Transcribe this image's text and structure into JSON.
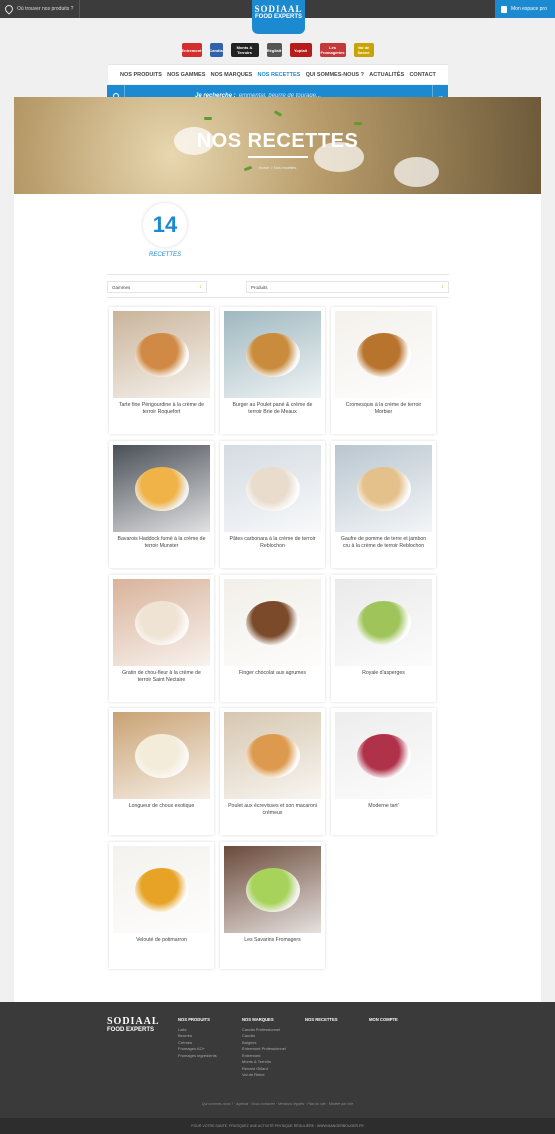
{
  "topbar": {
    "where_label": "Où trouver nos produits ?",
    "pro_label": "Mon espace pro"
  },
  "logo": {
    "line1": "SODIAAL",
    "line2": "FOOD EXPERTS"
  },
  "brands": [
    {
      "name": "Entremont",
      "color": "#d32f2f"
    },
    {
      "name": "Candia",
      "color": "#2f62a8"
    },
    {
      "name": "Monts & Terroirs",
      "color": "#222222"
    },
    {
      "name": "Régilait",
      "color": "#555555"
    },
    {
      "name": "Yoplait",
      "color": "#b71c1c"
    },
    {
      "name": "Les Fromageries",
      "color": "#c43a3a"
    },
    {
      "name": "Val de Saône",
      "color": "#c8a400"
    }
  ],
  "nav": [
    "NOS PRODUITS",
    "NOS GAMMES",
    "NOS MARQUES",
    "NOS RECETTES",
    "QUI SOMMES-NOUS ?",
    "ACTUALITÉS",
    "CONTACT"
  ],
  "nav_active_index": 3,
  "search": {
    "label": "Je recherche :",
    "placeholder": "emmental, beurre de tourage..."
  },
  "hero": {
    "title": "NOS RECETTES",
    "breadcrumb": "Home > Nos recettes"
  },
  "count": {
    "number": "14",
    "label": "RECETTES"
  },
  "filters": {
    "gammes": "Gammes",
    "produits": "Produits"
  },
  "recipes": [
    {
      "title": "Tarte fine Périgourdine à la crème de terroir Roquefort",
      "bg": "#c9b49a",
      "accent": "#d08a45"
    },
    {
      "title": "Burger au Poulet pané & crème de terroir Brie de Meaux",
      "bg": "#9fb8c0",
      "accent": "#c98b3c"
    },
    {
      "title": "Cromesquis à la crème de terroir Morbier",
      "bg": "#f4f1ec",
      "accent": "#b8732c"
    },
    {
      "title": "Bavarois Haddock fumé à la crème de terroir Munster",
      "bg": "#4a4f57",
      "accent": "#efb347"
    },
    {
      "title": "Pâtes carbonara à la crème de terroir Reblochon",
      "bg": "#d4dbe2",
      "accent": "#e9dccd"
    },
    {
      "title": "Gaufre de pomme de terre et jambon cru à la crème de terroir Reblochon",
      "bg": "#b9c6d0",
      "accent": "#e4c08a"
    },
    {
      "title": "Gratin de chou-fleur à la crème de terroir Saint Nectaire",
      "bg": "#d8b39a",
      "accent": "#efe3d3"
    },
    {
      "title": "Finger chocolat aux agrumes",
      "bg": "#f2efe9",
      "accent": "#7a4a2a"
    },
    {
      "title": "Royale d'asperges",
      "bg": "#eaeaea",
      "accent": "#9fc45a"
    },
    {
      "title": "Longueur de choux exotique",
      "bg": "#c9a273",
      "accent": "#f3ecd9"
    },
    {
      "title": "Poulet aux écrevisses et son macaroni crémeux",
      "bg": "#d6c7b0",
      "accent": "#dd9a4f"
    },
    {
      "title": "Moderne tart'",
      "bg": "#ededed",
      "accent": "#b0324a"
    },
    {
      "title": "Velouté de potimarron",
      "bg": "#f4f2ee",
      "accent": "#e6a326"
    },
    {
      "title": "Les Savarins Fromagers",
      "bg": "#6a4a3a",
      "accent": "#a7d35a"
    }
  ],
  "footer": {
    "logo_line1": "SODIAAL",
    "logo_line2": "FOOD EXPERTS",
    "columns": [
      {
        "title": "NOS PRODUITS",
        "items": [
          "Laits",
          "Beurres",
          "Crèmes",
          "Fromages AO+",
          "Fromages ingrédients"
        ]
      },
      {
        "title": "NOS MARQUES",
        "items": [
          "Candia Professionnel",
          "Candia",
          "Baignes",
          "Entremont Professionnel",
          "Entremont",
          "Monts & Terroirs",
          "Renard Gillard",
          "Val de Reine"
        ]
      },
      {
        "title": "NOS RECETTES",
        "items": []
      },
      {
        "title": "MON COMPTE",
        "items": []
      }
    ],
    "bottom_links": "Qui sommes-nous ? · Agenda · Nous contacter · Mentions légales · Plan du site · Modèle par rôle",
    "strip": "POUR VOTRE SANTÉ, PRATIQUEZ UNE ACTIVITÉ PHYSIQUE RÉGULIÈRE : WWW.MANGERBOUGER.FR"
  }
}
